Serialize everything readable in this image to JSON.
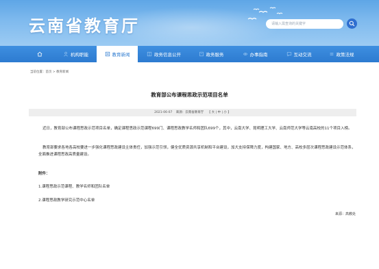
{
  "header": {
    "site_title": "云南省教育厅",
    "search_placeholder": "请输入需查询的关键字"
  },
  "nav": {
    "items": [
      {
        "label": "",
        "icon": "home-icon"
      },
      {
        "label": "机构职能",
        "icon": "org-icon"
      },
      {
        "label": "教育新闻",
        "icon": "news-icon",
        "active": true
      },
      {
        "label": "政务信息公开",
        "icon": "info-icon"
      },
      {
        "label": "政务服务",
        "icon": "service-icon"
      },
      {
        "label": "办事指南",
        "icon": "guide-icon"
      },
      {
        "label": "互动交流",
        "icon": "chat-icon"
      },
      {
        "label": "政策法规",
        "icon": "policy-icon"
      }
    ]
  },
  "breadcrumb": {
    "prefix": "当前位置：",
    "home": "首页",
    "sep": " > ",
    "section": "教育新闻"
  },
  "article": {
    "title": "教育部公布课程思政示范项目名单",
    "date": "2021-06-07",
    "source_label": "来源：云南省教育厅",
    "font_size_label": "【 大 | 中 | 小 】",
    "paragraphs": [
      "近日，教育部公布课程思政示范项目名单，确定课程思政示范课程699门、课程思政教学名师和团队699个，其中，云南大学、昆明理工大学、云南师范大学等云南高校的11个项目入榜。",
      "教育部要求各地各高校要进一步强化课程思政建设主体责任，加强示范引领，健全优质资源共享机制和平台建设，加大支持保障力度，构建国家、地方、高校多层次课程思政建设示范体系，全面推进课程思政高质量建设。"
    ],
    "attachments_title": "附件：",
    "attachments": [
      "1.课程思政示范课程、教学名师和团队名单",
      "2.课程思政教学研究示范中心名单"
    ],
    "footer_source": "来源：高教处"
  },
  "colors": {
    "banner_top": "#5ea6e6",
    "nav_blue": "#2d7bd0",
    "search_button": "#2f6fd0"
  }
}
